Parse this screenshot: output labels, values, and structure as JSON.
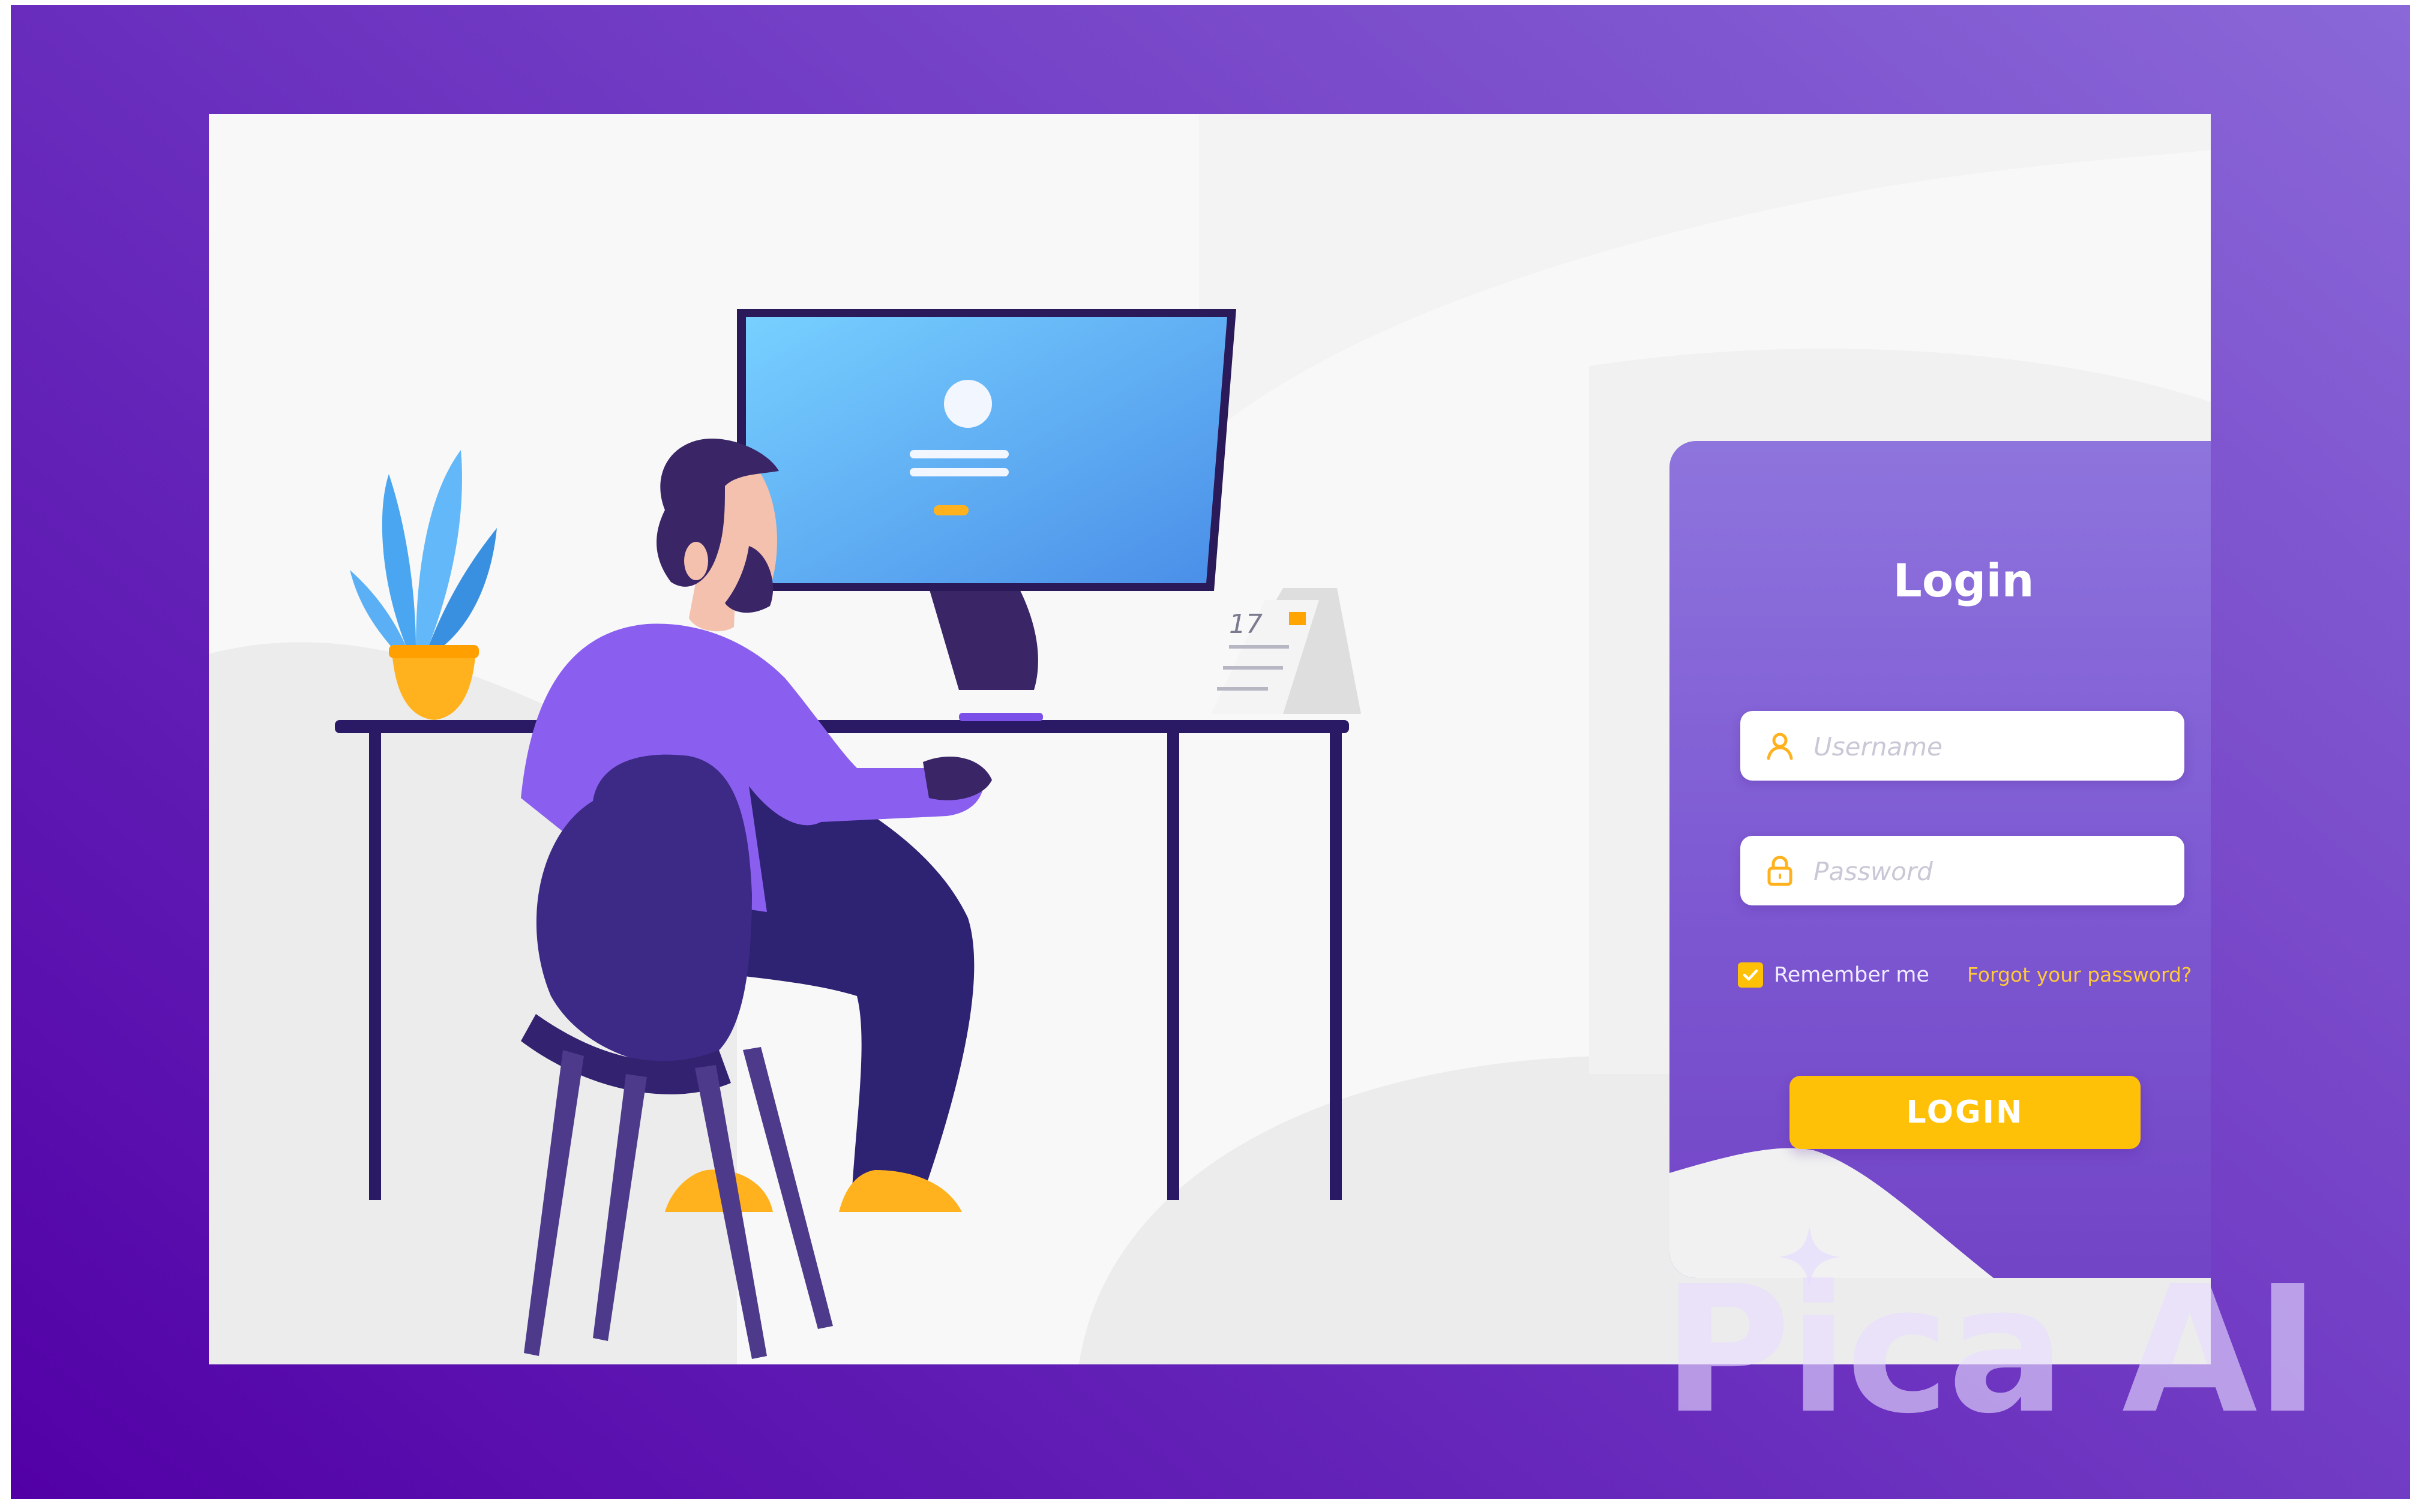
{
  "login_card": {
    "title": "Login",
    "username_placeholder": "Username",
    "password_placeholder": "Password",
    "remember_label": "Remember me",
    "remember_checked": true,
    "forgot_link": "Forgot your password?",
    "login_button": "LOGIN"
  },
  "illustration": {
    "calendar_day": "17"
  },
  "watermark": {
    "text": "Pica AI"
  },
  "colors": {
    "frame_purple": "#5a0fb0",
    "card_purple": "#7d58d2",
    "accent_yellow": "#ffc107",
    "monitor_blue": "#6ec3f5",
    "shirt_purple": "#8a5ff0",
    "pants_navy": "#2e2272"
  },
  "icons": [
    "user-icon",
    "lock-icon",
    "check-icon",
    "sparkle-icon"
  ]
}
